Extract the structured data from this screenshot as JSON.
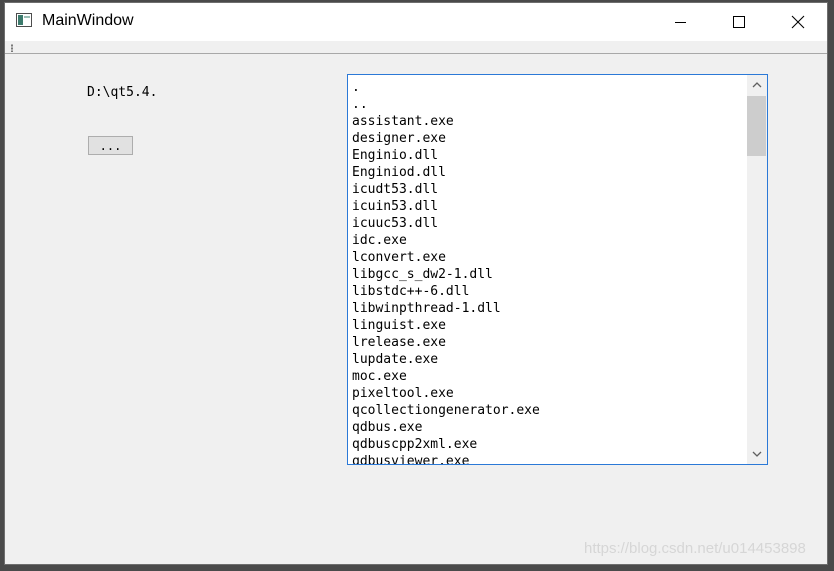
{
  "window": {
    "title": "MainWindow",
    "minimize_icon": "minimize-icon",
    "maximize_icon": "maximize-icon",
    "close_icon": "close-icon"
  },
  "main": {
    "path_label": "D:\\qt5.4.",
    "browse_button_label": "..."
  },
  "file_list": {
    "items": [
      ".",
      "..",
      "assistant.exe",
      "designer.exe",
      "Enginio.dll",
      "Enginiod.dll",
      "icudt53.dll",
      "icuin53.dll",
      "icuuc53.dll",
      "idc.exe",
      "lconvert.exe",
      "libgcc_s_dw2-1.dll",
      "libstdc++-6.dll",
      "libwinpthread-1.dll",
      "linguist.exe",
      "lrelease.exe",
      "lupdate.exe",
      "moc.exe",
      "pixeltool.exe",
      "qcollectiongenerator.exe",
      "qdbus.exe",
      "qdbuscpp2xml.exe",
      "qdbusviewer.exe"
    ]
  },
  "watermark": "https://blog.csdn.net/u014453898",
  "colors": {
    "list_border": "#2b79d7",
    "window_background": "#f0f0f0",
    "scroll_thumb": "#cdcdcd"
  }
}
